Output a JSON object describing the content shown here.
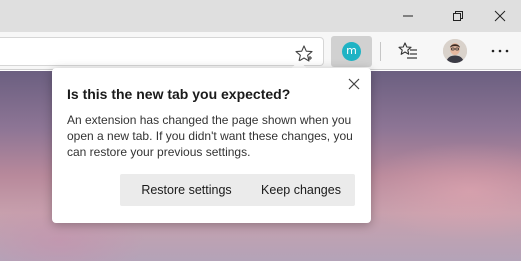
{
  "window": {
    "controls": [
      "minimize-icon",
      "restore-icon",
      "close-icon"
    ]
  },
  "toolbar": {
    "favorite_icon": "star-outline-icon",
    "extension": {
      "icon": "extension-icon",
      "letter": "m",
      "color": "#1fb3c4"
    },
    "favorites_icon": "favorites-list-icon",
    "profile_icon": "avatar",
    "more_icon": "ellipsis-icon"
  },
  "popup": {
    "title": "Is this the new tab you expected?",
    "body": "An extension has changed the page shown when you open a new tab. If you didn't want these changes, you can restore your previous settings.",
    "close_icon": "close-icon",
    "buttons": {
      "restore": "Restore settings",
      "keep": "Keep changes"
    }
  }
}
